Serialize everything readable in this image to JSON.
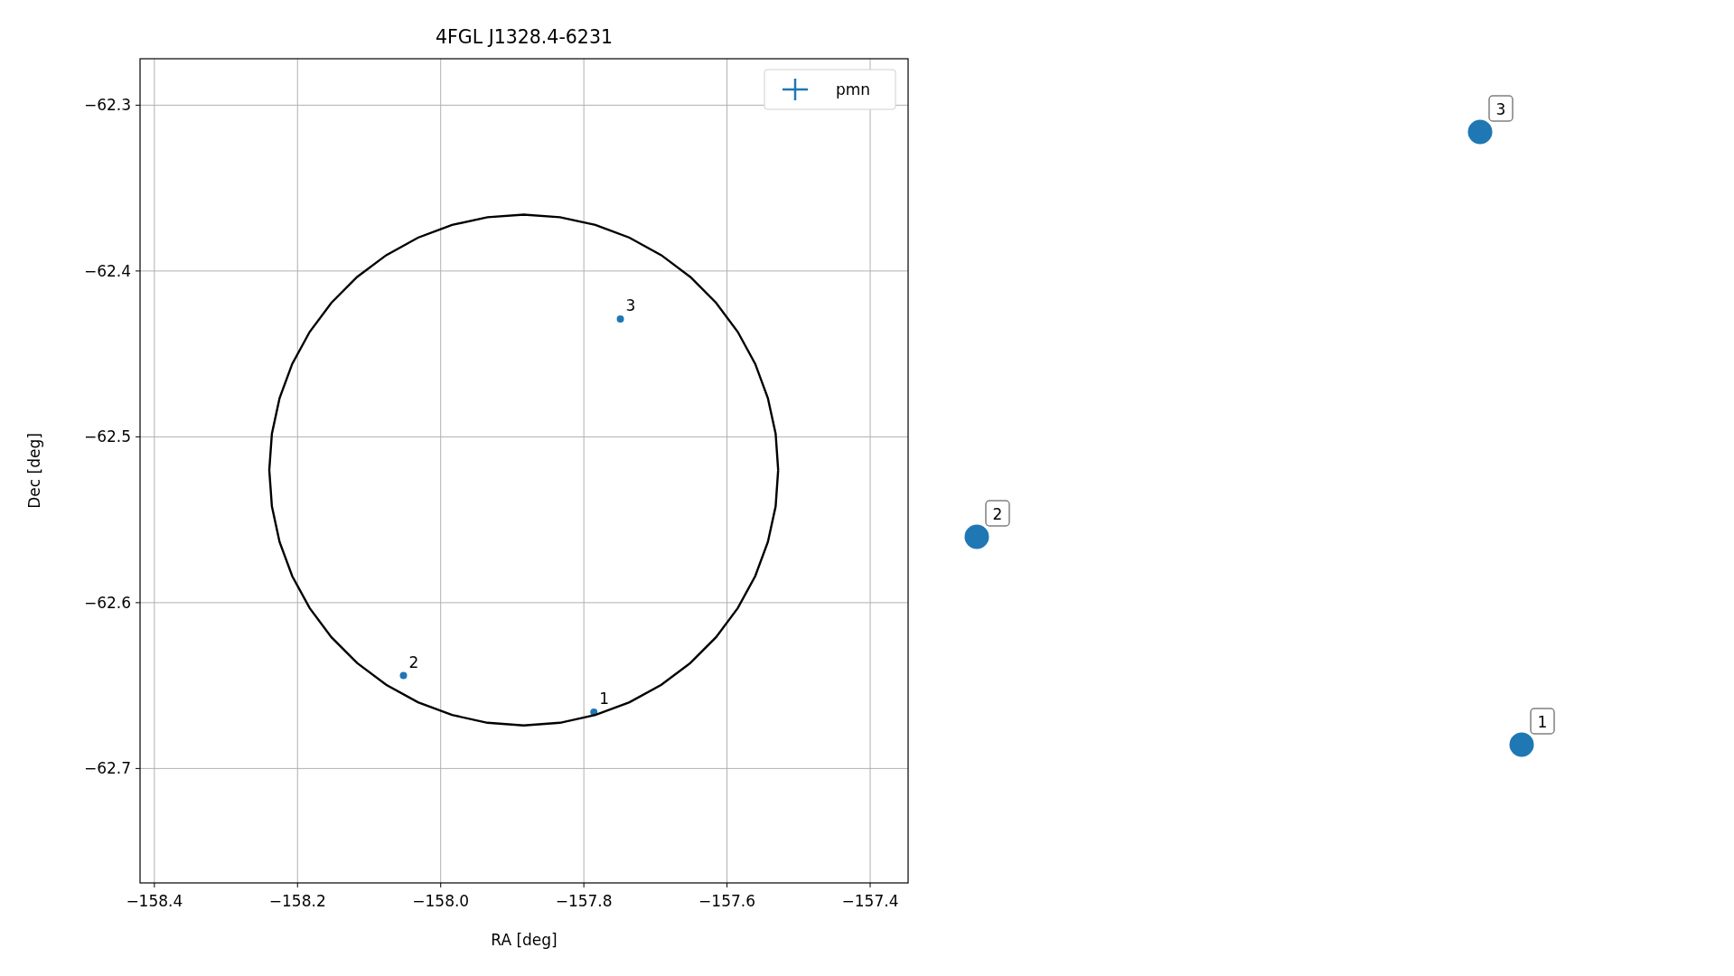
{
  "chart_data": {
    "type": "scatter",
    "title": "4FGL J1328.4-6231",
    "xlabel": "RA [deg]",
    "ylabel": "Dec [deg]",
    "xlim": [
      -158.42,
      -157.347
    ],
    "ylim": [
      -62.769,
      -62.272
    ],
    "xticks": [
      {
        "value": -158.4,
        "label": "−158.4"
      },
      {
        "value": -158.2,
        "label": "−158.2"
      },
      {
        "value": -158.0,
        "label": "−158.0"
      },
      {
        "value": -157.8,
        "label": "−157.8"
      },
      {
        "value": -157.6,
        "label": "−157.6"
      },
      {
        "value": -157.4,
        "label": "−157.4"
      }
    ],
    "yticks": [
      {
        "value": -62.3,
        "label": "−62.3"
      },
      {
        "value": -62.4,
        "label": "−62.4"
      },
      {
        "value": -62.5,
        "label": "−62.5"
      },
      {
        "value": -62.6,
        "label": "−62.6"
      },
      {
        "value": -62.7,
        "label": "−62.7"
      }
    ],
    "grid": true,
    "series": [
      {
        "name": "pmn",
        "color": "#1f77b4",
        "x": [
          -157.786,
          -158.052,
          -157.749
        ],
        "values": [
          -62.666,
          -62.644,
          -62.429
        ]
      }
    ],
    "annotations": [
      {
        "text": "1",
        "x": -157.786,
        "y": -62.666
      },
      {
        "text": "2",
        "x": -158.052,
        "y": -62.644
      },
      {
        "text": "3",
        "x": -157.749,
        "y": -62.429
      }
    ]
  },
  "markers": [
    {
      "label": "1",
      "color": "#1f77b4"
    },
    {
      "label": "2",
      "color": "#1f77b4"
    },
    {
      "label": "3",
      "color": "#1f77b4"
    }
  ]
}
